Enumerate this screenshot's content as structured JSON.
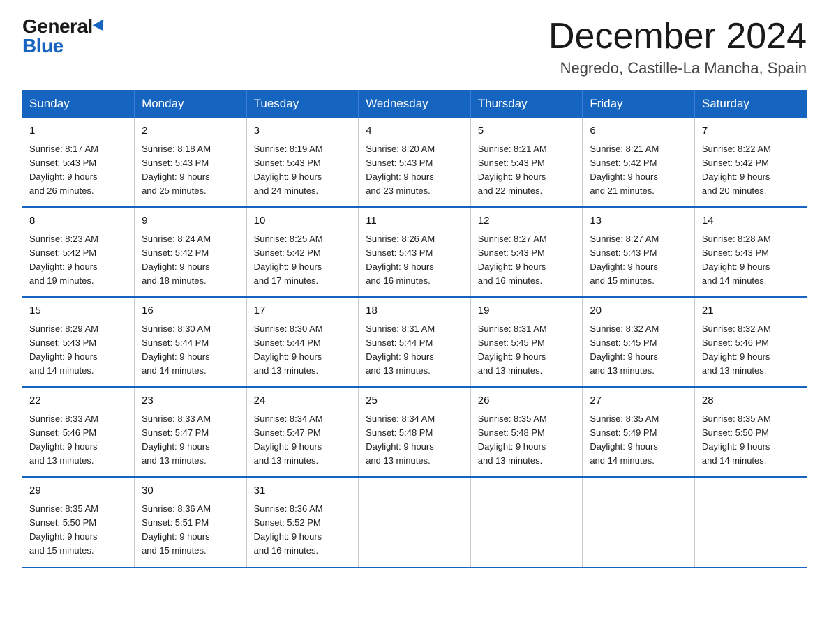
{
  "logo": {
    "general": "General",
    "blue": "Blue"
  },
  "title": "December 2024",
  "location": "Negredo, Castille-La Mancha, Spain",
  "days_of_week": [
    "Sunday",
    "Monday",
    "Tuesday",
    "Wednesday",
    "Thursday",
    "Friday",
    "Saturday"
  ],
  "weeks": [
    [
      {
        "day": "1",
        "sunrise": "8:17 AM",
        "sunset": "5:43 PM",
        "daylight": "9 hours and 26 minutes."
      },
      {
        "day": "2",
        "sunrise": "8:18 AM",
        "sunset": "5:43 PM",
        "daylight": "9 hours and 25 minutes."
      },
      {
        "day": "3",
        "sunrise": "8:19 AM",
        "sunset": "5:43 PM",
        "daylight": "9 hours and 24 minutes."
      },
      {
        "day": "4",
        "sunrise": "8:20 AM",
        "sunset": "5:43 PM",
        "daylight": "9 hours and 23 minutes."
      },
      {
        "day": "5",
        "sunrise": "8:21 AM",
        "sunset": "5:43 PM",
        "daylight": "9 hours and 22 minutes."
      },
      {
        "day": "6",
        "sunrise": "8:21 AM",
        "sunset": "5:42 PM",
        "daylight": "9 hours and 21 minutes."
      },
      {
        "day": "7",
        "sunrise": "8:22 AM",
        "sunset": "5:42 PM",
        "daylight": "9 hours and 20 minutes."
      }
    ],
    [
      {
        "day": "8",
        "sunrise": "8:23 AM",
        "sunset": "5:42 PM",
        "daylight": "9 hours and 19 minutes."
      },
      {
        "day": "9",
        "sunrise": "8:24 AM",
        "sunset": "5:42 PM",
        "daylight": "9 hours and 18 minutes."
      },
      {
        "day": "10",
        "sunrise": "8:25 AM",
        "sunset": "5:42 PM",
        "daylight": "9 hours and 17 minutes."
      },
      {
        "day": "11",
        "sunrise": "8:26 AM",
        "sunset": "5:43 PM",
        "daylight": "9 hours and 16 minutes."
      },
      {
        "day": "12",
        "sunrise": "8:27 AM",
        "sunset": "5:43 PM",
        "daylight": "9 hours and 16 minutes."
      },
      {
        "day": "13",
        "sunrise": "8:27 AM",
        "sunset": "5:43 PM",
        "daylight": "9 hours and 15 minutes."
      },
      {
        "day": "14",
        "sunrise": "8:28 AM",
        "sunset": "5:43 PM",
        "daylight": "9 hours and 14 minutes."
      }
    ],
    [
      {
        "day": "15",
        "sunrise": "8:29 AM",
        "sunset": "5:43 PM",
        "daylight": "9 hours and 14 minutes."
      },
      {
        "day": "16",
        "sunrise": "8:30 AM",
        "sunset": "5:44 PM",
        "daylight": "9 hours and 14 minutes."
      },
      {
        "day": "17",
        "sunrise": "8:30 AM",
        "sunset": "5:44 PM",
        "daylight": "9 hours and 13 minutes."
      },
      {
        "day": "18",
        "sunrise": "8:31 AM",
        "sunset": "5:44 PM",
        "daylight": "9 hours and 13 minutes."
      },
      {
        "day": "19",
        "sunrise": "8:31 AM",
        "sunset": "5:45 PM",
        "daylight": "9 hours and 13 minutes."
      },
      {
        "day": "20",
        "sunrise": "8:32 AM",
        "sunset": "5:45 PM",
        "daylight": "9 hours and 13 minutes."
      },
      {
        "day": "21",
        "sunrise": "8:32 AM",
        "sunset": "5:46 PM",
        "daylight": "9 hours and 13 minutes."
      }
    ],
    [
      {
        "day": "22",
        "sunrise": "8:33 AM",
        "sunset": "5:46 PM",
        "daylight": "9 hours and 13 minutes."
      },
      {
        "day": "23",
        "sunrise": "8:33 AM",
        "sunset": "5:47 PM",
        "daylight": "9 hours and 13 minutes."
      },
      {
        "day": "24",
        "sunrise": "8:34 AM",
        "sunset": "5:47 PM",
        "daylight": "9 hours and 13 minutes."
      },
      {
        "day": "25",
        "sunrise": "8:34 AM",
        "sunset": "5:48 PM",
        "daylight": "9 hours and 13 minutes."
      },
      {
        "day": "26",
        "sunrise": "8:35 AM",
        "sunset": "5:48 PM",
        "daylight": "9 hours and 13 minutes."
      },
      {
        "day": "27",
        "sunrise": "8:35 AM",
        "sunset": "5:49 PM",
        "daylight": "9 hours and 14 minutes."
      },
      {
        "day": "28",
        "sunrise": "8:35 AM",
        "sunset": "5:50 PM",
        "daylight": "9 hours and 14 minutes."
      }
    ],
    [
      {
        "day": "29",
        "sunrise": "8:35 AM",
        "sunset": "5:50 PM",
        "daylight": "9 hours and 15 minutes."
      },
      {
        "day": "30",
        "sunrise": "8:36 AM",
        "sunset": "5:51 PM",
        "daylight": "9 hours and 15 minutes."
      },
      {
        "day": "31",
        "sunrise": "8:36 AM",
        "sunset": "5:52 PM",
        "daylight": "9 hours and 16 minutes."
      },
      null,
      null,
      null,
      null
    ]
  ],
  "labels": {
    "sunrise": "Sunrise:",
    "sunset": "Sunset:",
    "daylight": "Daylight:"
  }
}
